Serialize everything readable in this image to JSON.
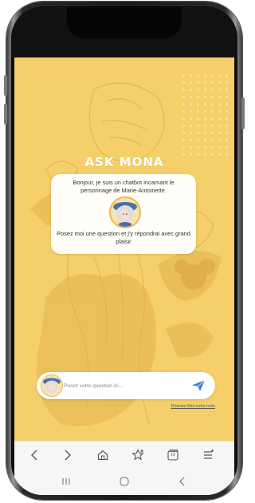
{
  "app": {
    "title": "ASK MONA",
    "greeting": "Bonjour, je suis un chatbot incarnant le personnage de Marie-Antoinette.",
    "prompt": "Posez moi une question et j'y répondrai avec grand plaisir"
  },
  "input": {
    "placeholder": "Posez votre question ici..."
  },
  "feedback": {
    "label": "Donnez Moi votre note"
  },
  "browser_nav": {
    "icons": [
      "back-icon",
      "forward-icon",
      "home-icon",
      "favorite-add-icon",
      "tabs-icon",
      "menu-icon"
    ],
    "tabs_count": "19"
  },
  "system_nav": {
    "icons": [
      "recents-icon",
      "home-circle-icon",
      "back-chevron-icon"
    ]
  },
  "colors": {
    "screen_bg": "#f4cf6a",
    "accent_blue": "#3b7fd6",
    "avatar_ring": "#e9b94a"
  }
}
